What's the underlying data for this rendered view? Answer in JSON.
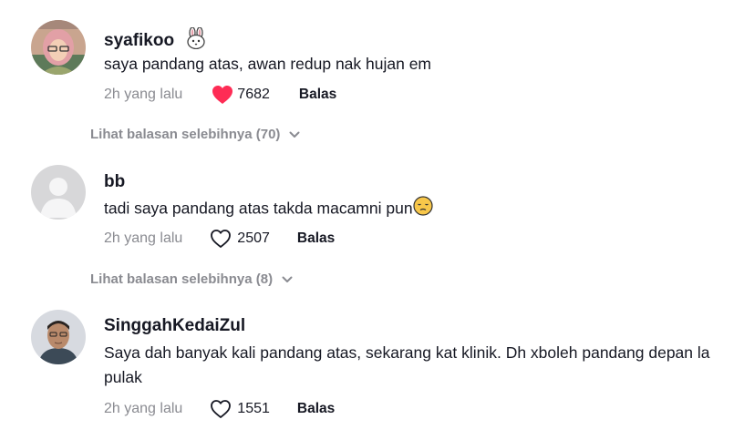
{
  "comments": [
    {
      "username": "syafikoo",
      "username_emoji": "rabbit-face-emoji",
      "text": "saya pandang atas, awan redup nak hujan em",
      "time": "2h yang lalu",
      "likes": "7682",
      "liked": true,
      "reply_label": "Balas",
      "view_replies": "Lihat balasan selebihnya (70)"
    },
    {
      "username": "bb",
      "text": "tadi saya pandang atas takda macamni pun",
      "text_emoji": "pensive-face-emoji",
      "time": "2h yang lalu",
      "likes": "2507",
      "liked": false,
      "reply_label": "Balas",
      "view_replies": "Lihat balasan selebihnya (8)"
    },
    {
      "username": "SinggahKedaiZul",
      "text": "Saya dah banyak kali pandang atas, sekarang kat klinik. Dh xboleh pandang depan la pulak",
      "time": "2h yang lalu",
      "likes": "1551",
      "liked": false,
      "reply_label": "Balas"
    }
  ],
  "colors": {
    "like_active": "#fe2c55",
    "muted": "#8a8b91",
    "text": "#161823"
  }
}
